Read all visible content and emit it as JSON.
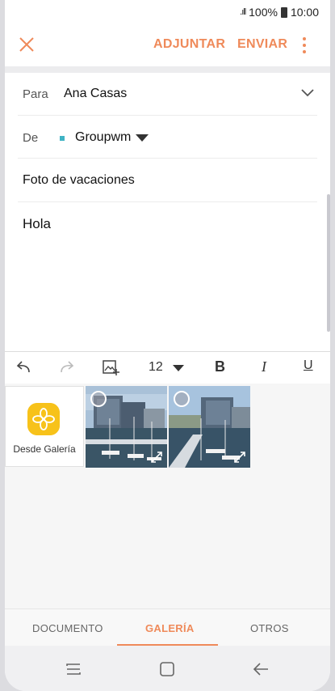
{
  "status_bar": {
    "signal": ".ıll",
    "battery_percent": "100%",
    "time": "10:00"
  },
  "action_bar": {
    "attach_label": "ADJUNTAR",
    "send_label": "ENVIAR"
  },
  "to_field": {
    "label": "Para",
    "value": "Ana Casas"
  },
  "from_field": {
    "label": "De",
    "value": "Groupwm"
  },
  "subject": {
    "value": "Foto de vacaciones"
  },
  "body": {
    "text": "Hola"
  },
  "toolbar": {
    "font_size": "12",
    "bold": "B",
    "italic": "I",
    "underline": "U"
  },
  "gallery": {
    "source_label": "Desde Galería",
    "thumbnails": 2
  },
  "tabs": {
    "document": "DOCUMENTO",
    "gallery": "GALERÍA",
    "others": "OTROS",
    "active": "GALERÍA"
  },
  "colors": {
    "accent": "#ef8a5a",
    "account_dot": "#3fb3c4",
    "gallery_icon": "#f7c21a"
  }
}
